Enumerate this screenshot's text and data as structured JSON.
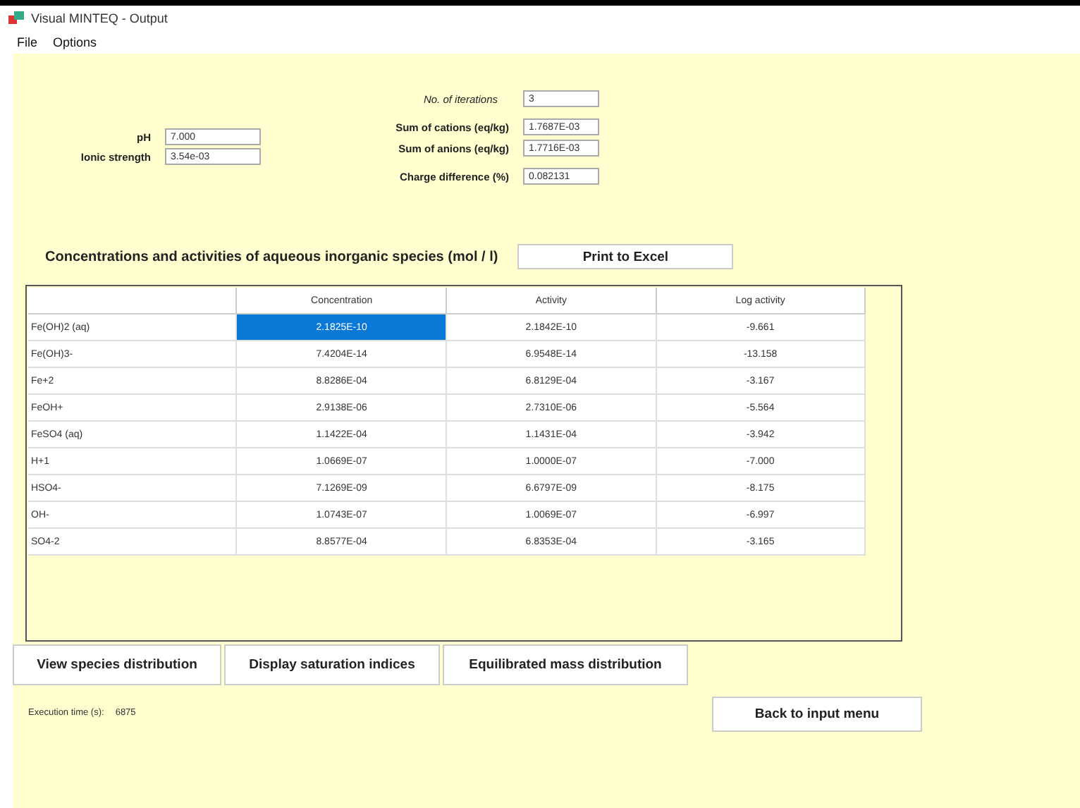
{
  "window": {
    "title": "Visual MINTEQ - Output"
  },
  "menu": [
    "File",
    "Options"
  ],
  "left_fields": [
    {
      "label": "pH",
      "value": "7.000"
    },
    {
      "label": "Ionic strength",
      "value": "3.54e-03"
    }
  ],
  "iterations": {
    "label": "No. of iterations",
    "value": "3"
  },
  "sum_fields": [
    {
      "label": "Sum of cations (eq/kg)",
      "value": "1.7687E-03"
    },
    {
      "label": "Sum of anions (eq/kg)",
      "value": "1.7716E-03"
    }
  ],
  "charge": {
    "label": "Charge difference (%)",
    "value": "0.082131"
  },
  "section_title": "Concentrations and activities of aqueous inorganic species (mol / l)",
  "print_button": "Print to Excel",
  "table": {
    "columns": [
      "",
      "Concentration",
      "Activity",
      "Log activity"
    ],
    "rows": [
      {
        "cells": [
          {
            "text": "Fe(OH)2 (aq)",
            "selected": false
          },
          {
            "text": "2.1825E-10",
            "selected": true
          },
          {
            "text": "2.1842E-10",
            "selected": false
          },
          {
            "text": "-9.661",
            "selected": false
          }
        ]
      },
      {
        "cells": [
          {
            "text": "Fe(OH)3-",
            "selected": false
          },
          {
            "text": "7.4204E-14",
            "selected": false
          },
          {
            "text": "6.9548E-14",
            "selected": false
          },
          {
            "text": "-13.158",
            "selected": false
          }
        ]
      },
      {
        "cells": [
          {
            "text": "Fe+2",
            "selected": false
          },
          {
            "text": "8.8286E-04",
            "selected": false
          },
          {
            "text": "6.8129E-04",
            "selected": false
          },
          {
            "text": "-3.167",
            "selected": false
          }
        ]
      },
      {
        "cells": [
          {
            "text": "FeOH+",
            "selected": false
          },
          {
            "text": "2.9138E-06",
            "selected": false
          },
          {
            "text": "2.7310E-06",
            "selected": false
          },
          {
            "text": "-5.564",
            "selected": false
          }
        ]
      },
      {
        "cells": [
          {
            "text": "FeSO4 (aq)",
            "selected": false
          },
          {
            "text": "1.1422E-04",
            "selected": false
          },
          {
            "text": "1.1431E-04",
            "selected": false
          },
          {
            "text": "-3.942",
            "selected": false
          }
        ]
      },
      {
        "cells": [
          {
            "text": "H+1",
            "selected": false
          },
          {
            "text": "1.0669E-07",
            "selected": false
          },
          {
            "text": "1.0000E-07",
            "selected": false
          },
          {
            "text": "-7.000",
            "selected": false
          }
        ]
      },
      {
        "cells": [
          {
            "text": "HSO4-",
            "selected": false
          },
          {
            "text": "7.1269E-09",
            "selected": false
          },
          {
            "text": "6.6797E-09",
            "selected": false
          },
          {
            "text": "-8.175",
            "selected": false
          }
        ]
      },
      {
        "cells": [
          {
            "text": "OH-",
            "selected": false
          },
          {
            "text": "1.0743E-07",
            "selected": false
          },
          {
            "text": "1.0069E-07",
            "selected": false
          },
          {
            "text": "-6.997",
            "selected": false
          }
        ]
      },
      {
        "cells": [
          {
            "text": "SO4-2",
            "selected": false
          },
          {
            "text": "8.8577E-04",
            "selected": false
          },
          {
            "text": "6.8353E-04",
            "selected": false
          },
          {
            "text": "-3.165",
            "selected": false
          }
        ]
      }
    ]
  },
  "bottom_buttons": [
    "View species distribution",
    "Display saturation indices",
    "Equilibrated mass distribution"
  ],
  "execution": {
    "label": "Execution time (s):",
    "value": "6875"
  },
  "back_button": "Back to input menu"
}
